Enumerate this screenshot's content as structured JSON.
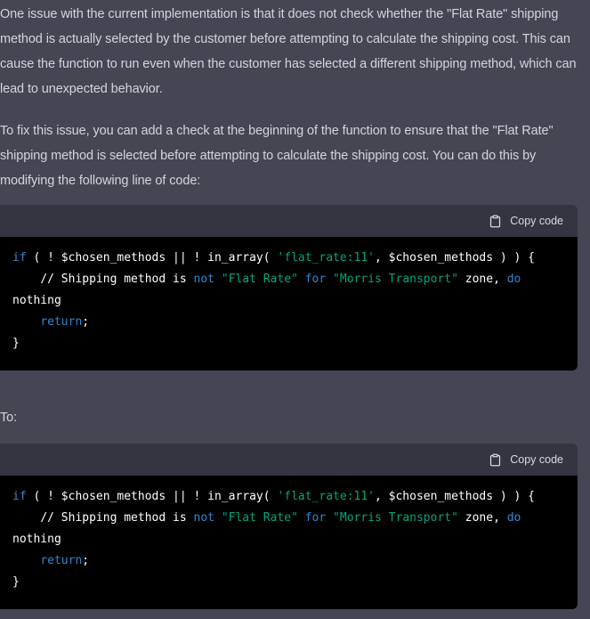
{
  "colors": {
    "page_background": "#444654",
    "body_text": "#d1d5db",
    "code_header_background": "#343541",
    "code_header_text": "#d9d9e3",
    "code_body_background": "#000000",
    "code_default_text": "#ffffff",
    "code_keyword": "#3087d1",
    "code_string": "#00a67d"
  },
  "paragraphs": [
    "One issue with the current implementation is that it does not check whether the \"Flat Rate\" shipping method is actually selected by the customer before attempting to calculate the shipping cost. This can cause the function to run even when the customer has selected a different shipping method, which can lead to unexpected behavior.",
    "To fix this issue, you can add a check at the beginning of the function to ensure that the \"Flat Rate\" shipping method is selected before attempting to calculate the shipping cost. You can do this by modifying the following line of code:",
    "To:"
  ],
  "code_block": {
    "copy_label": "Copy code",
    "lines": [
      [
        [
          "keyword",
          "if"
        ],
        [
          "plain",
          " ( ! $chosen_methods || ! in_array( "
        ],
        [
          "string",
          "'flat_rate:11'"
        ],
        [
          "plain",
          ", $chosen_methods ) ) {"
        ]
      ],
      [
        [
          "plain",
          "    // Shipping method is "
        ],
        [
          "keyword",
          "not"
        ],
        [
          "plain",
          " "
        ],
        [
          "string",
          "\"Flat Rate\""
        ],
        [
          "plain",
          " "
        ],
        [
          "keyword",
          "for"
        ],
        [
          "plain",
          " "
        ],
        [
          "string",
          "\"Morris Transport\""
        ],
        [
          "plain",
          " zone, "
        ],
        [
          "keyword",
          "do"
        ],
        [
          "plain",
          " nothing"
        ]
      ],
      [
        [
          "plain",
          "    "
        ],
        [
          "keyword",
          "return"
        ],
        [
          "plain",
          ";"
        ]
      ],
      [
        [
          "plain",
          "}"
        ]
      ]
    ]
  }
}
